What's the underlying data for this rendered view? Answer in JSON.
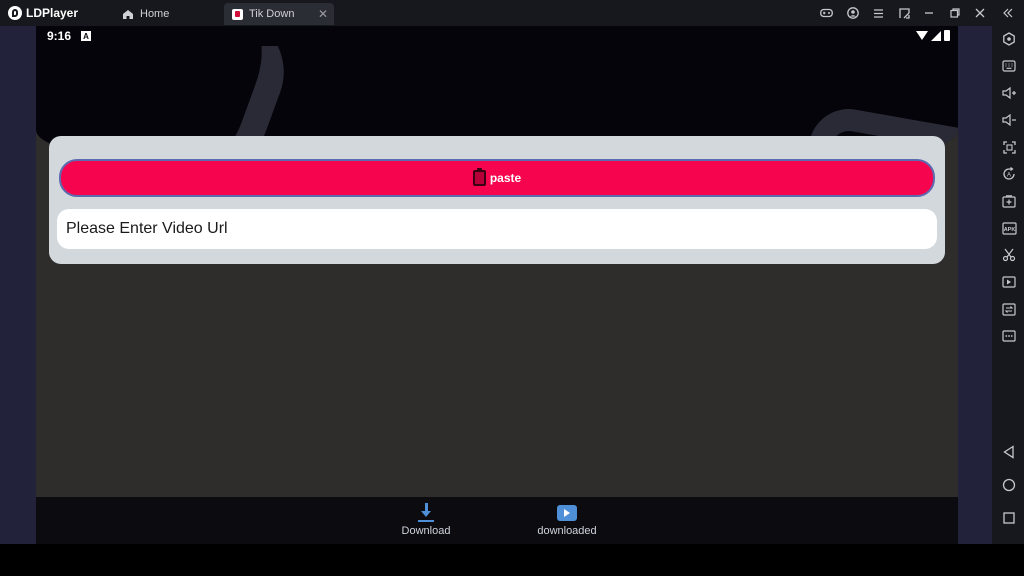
{
  "window": {
    "app_name": "LDPlayer",
    "tabs": [
      {
        "label": "Home",
        "icon": "home-icon"
      },
      {
        "label": "Tik Down",
        "icon": "tik-down-app-icon",
        "close": "✕"
      }
    ],
    "controls": [
      "gamepad-icon",
      "user-icon",
      "menu-icon",
      "restore-layout-icon",
      "minimize-icon",
      "maximize-icon",
      "close-icon",
      "collapse-sidebar-icon"
    ]
  },
  "statusbar": {
    "time": "9:16",
    "notification": "A"
  },
  "main": {
    "paste_label": "paste",
    "url_placeholder": "Please Enter Video Url",
    "url_value": ""
  },
  "bottom_nav": {
    "items": [
      {
        "label": "Download",
        "icon": "download-icon"
      },
      {
        "label": "downloaded",
        "icon": "downloaded-folder-icon"
      }
    ]
  },
  "sidebar": {
    "tools": [
      "settings-icon",
      "keyboard-icon",
      "volume-up-icon",
      "volume-down-icon",
      "screenshot-icon",
      "rotate-icon",
      "add-screen-icon",
      "apk-icon",
      "scissors-icon",
      "video-icon",
      "sync-icon",
      "more-icon"
    ],
    "nav": [
      "back-icon",
      "home-circle-icon",
      "recents-icon"
    ]
  },
  "colors": {
    "accent": "#f7044f",
    "card": "#d3d8dd",
    "screen_bg": "#2f2d2c",
    "nav_icon": "#4f8fd8"
  }
}
